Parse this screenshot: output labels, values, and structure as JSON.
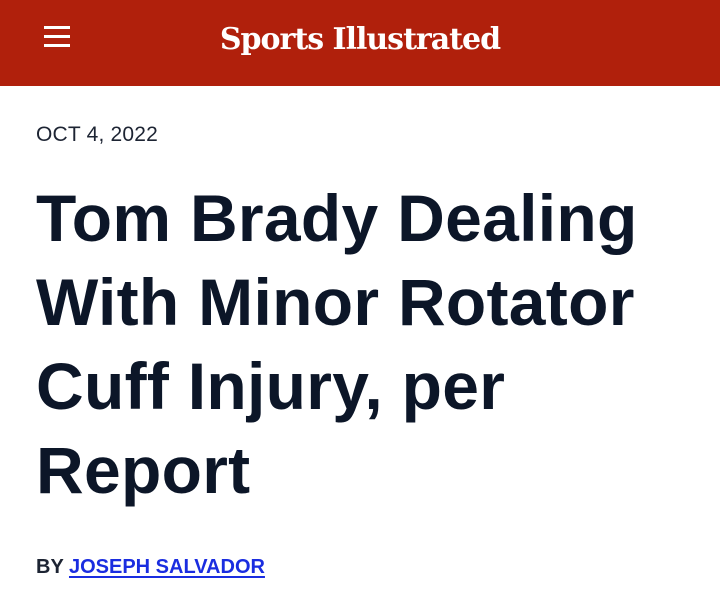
{
  "header": {
    "brand": "Sports Illustrated",
    "menu_icon": "hamburger-menu-icon",
    "background_color": "#b0200c"
  },
  "article": {
    "date": "OCT 4, 2022",
    "title": "Tom Brady Dealing With Minor Rotator Cuff Injury, per Report",
    "byline_prefix": "BY",
    "author": "JOSEPH SALVADOR",
    "author_link_color": "#1a2de0"
  }
}
